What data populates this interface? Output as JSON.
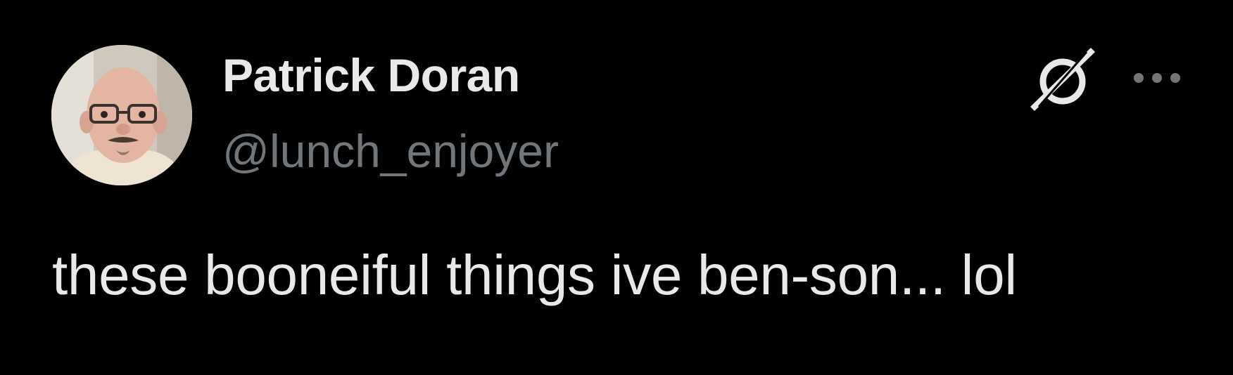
{
  "author": {
    "display_name": "Patrick Doran",
    "handle": "@lunch_enjoyer",
    "avatar_icon": "user-avatar-photo"
  },
  "actions": {
    "grok_icon": "grok-icon",
    "more_icon": "more-options-icon"
  },
  "tweet": {
    "text": "these booneiful things ive ben-son... lol"
  },
  "colors": {
    "background": "#000000",
    "primary_text": "#e7e9ea",
    "secondary_text": "#71767b"
  }
}
